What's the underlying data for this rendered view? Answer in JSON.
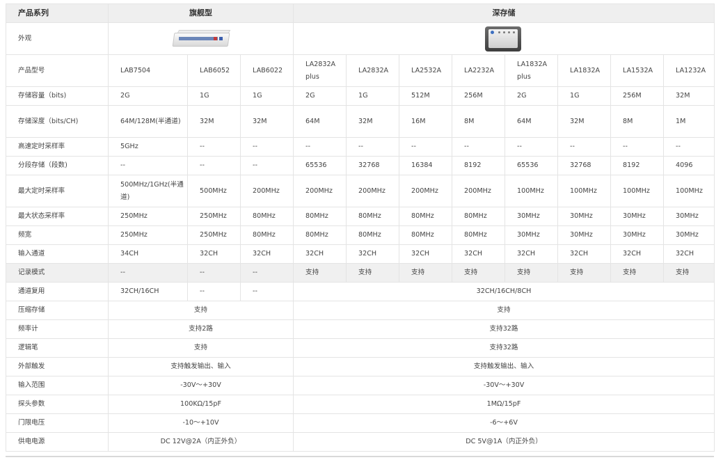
{
  "header": {
    "series_label": "产品系列",
    "flagship_label": "旗舰型",
    "deep_label": "深存储"
  },
  "appearance": {
    "label": "外观",
    "flagship_image": "flagship-device-image",
    "deep_image": "deep-storage-device-image"
  },
  "models": {
    "label": "产品型号",
    "values": [
      "LAB7504",
      "LAB6052",
      "LAB6022",
      "LA2832A plus",
      "LA2832A",
      "LA2532A",
      "LA2232A",
      "LA1832A plus",
      "LA1832A",
      "LA1532A",
      "LA1232A"
    ]
  },
  "rows": [
    {
      "label": "存储容量（bits)",
      "values": [
        "2G",
        "1G",
        "1G",
        "2G",
        "1G",
        "512M",
        "256M",
        "2G",
        "1G",
        "256M",
        "32M"
      ]
    },
    {
      "label": "存储深度（bits/CH)",
      "values": [
        "64M/128M(半通道)",
        "32M",
        "32M",
        "64M",
        "32M",
        "16M",
        "8M",
        "64M",
        "32M",
        "8M",
        "1M"
      ]
    },
    {
      "label": "高速定时采样率",
      "values": [
        "5GHz",
        "--",
        "--",
        "--",
        "--",
        "--",
        "--",
        "--",
        "--",
        "--",
        "--"
      ]
    },
    {
      "label": "分段存储（段数)",
      "values": [
        "--",
        "--",
        "--",
        "65536",
        "32768",
        "16384",
        "8192",
        "65536",
        "32768",
        "8192",
        "4096"
      ]
    },
    {
      "label": "最大定时采样率",
      "values": [
        "500MHz/1GHz(半通道)",
        "500MHz",
        "200MHz",
        "200MHz",
        "200MHz",
        "200MHz",
        "200MHz",
        "100MHz",
        "100MHz",
        "100MHz",
        "100MHz"
      ]
    },
    {
      "label": "最大状态采样率",
      "values": [
        "250MHz",
        "250MHz",
        "80MHz",
        "80MHz",
        "80MHz",
        "80MHz",
        "80MHz",
        "30MHz",
        "30MHz",
        "30MHz",
        "30MHz"
      ]
    },
    {
      "label": "频宽",
      "values": [
        "250MHz",
        "250MHz",
        "80MHz",
        "80MHz",
        "80MHz",
        "80MHz",
        "80MHz",
        "30MHz",
        "30MHz",
        "30MHz",
        "30MHz"
      ]
    },
    {
      "label": "输入通道",
      "values": [
        "34CH",
        "32CH",
        "32CH",
        "32CH",
        "32CH",
        "32CH",
        "32CH",
        "32CH",
        "32CH",
        "32CH",
        "32CH"
      ]
    },
    {
      "label": "记录模式",
      "values": [
        "--",
        "--",
        "--",
        "支持",
        "支持",
        "支持",
        "支持",
        "支持",
        "支持",
        "支持",
        "支持"
      ]
    }
  ],
  "channel_reuse": {
    "label": "通道复用",
    "flag_values": [
      "32CH/16CH",
      "--",
      "--"
    ],
    "deep_value": "32CH/16CH/8CH"
  },
  "merged_rows": [
    {
      "label": "压缩存储",
      "flagship": "支持",
      "deep": "支持"
    },
    {
      "label": "频率计",
      "flagship": "支持2路",
      "deep": "支持32路"
    },
    {
      "label": "逻辑笔",
      "flagship": "支持",
      "deep": "支持32路"
    },
    {
      "label": "外部触发",
      "flagship": "支持触发输出、输入",
      "deep": "支持触发输出、输入"
    },
    {
      "label": "输入范围",
      "flagship": "-30V～+30V",
      "deep": "-30V～+30V"
    },
    {
      "label": "探头参数",
      "flagship": "100KΩ/15pF",
      "deep": "1MΩ/15pF"
    },
    {
      "label": "门限电压",
      "flagship": "-10～+10V",
      "deep": "-6～+6V"
    },
    {
      "label": "供电电源",
      "flagship": "DC 12V@2A（内正外负）",
      "deep": "DC 5V@1A（内正外负）"
    }
  ]
}
